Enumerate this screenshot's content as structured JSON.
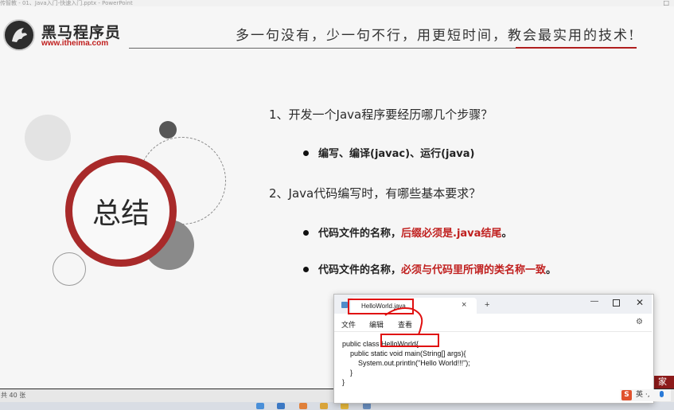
{
  "window": {
    "title": "传智教 - 01、Java入门-快速入门.pptx - PowerPoint",
    "close_glyph": "□"
  },
  "header": {
    "brand_name": "黑马程序员",
    "brand_url": "www.itheima.com",
    "slogan": "多一句没有，少一句不行，用更短时间，教会最实用的技术!"
  },
  "summary": {
    "label": "总结"
  },
  "content": {
    "q1": "1、开发一个Java程序要经历哪几个步骤？",
    "q1_bullet": "编写、编译(javac)、运行(java)",
    "q2": "2、Java代码编写时，有哪些基本要求？",
    "q2_bullet1_prefix": "代码文件的名称，",
    "q2_bullet1_red": "后缀必须是.java结尾",
    "q2_bullet1_suffix": "。",
    "q2_bullet2_prefix": "代码文件的名称，",
    "q2_bullet2_red": "必须与代码里所谓的类名称一致",
    "q2_bullet2_suffix": "。",
    "corner_char": "家"
  },
  "statusbar": {
    "slide_count": "共 40 张"
  },
  "notepad": {
    "tab_title": "HelloWorld.java",
    "close_tab": "×",
    "new_tab": "+",
    "minimize": "—",
    "close": "✕",
    "menus": [
      "文件",
      "编辑",
      "查看"
    ],
    "code_lines": [
      "public class HelloWorld{",
      "    public static void main(String[] args){",
      "        System.out.println(\"Hello World!!!\");",
      "    }",
      "}"
    ]
  },
  "ime": {
    "logo": "S",
    "text": "英 ·,"
  },
  "colors": {
    "brand_red": "#c0201f",
    "circle_red": "#a82a2a",
    "annotation_red": "#e01010"
  }
}
